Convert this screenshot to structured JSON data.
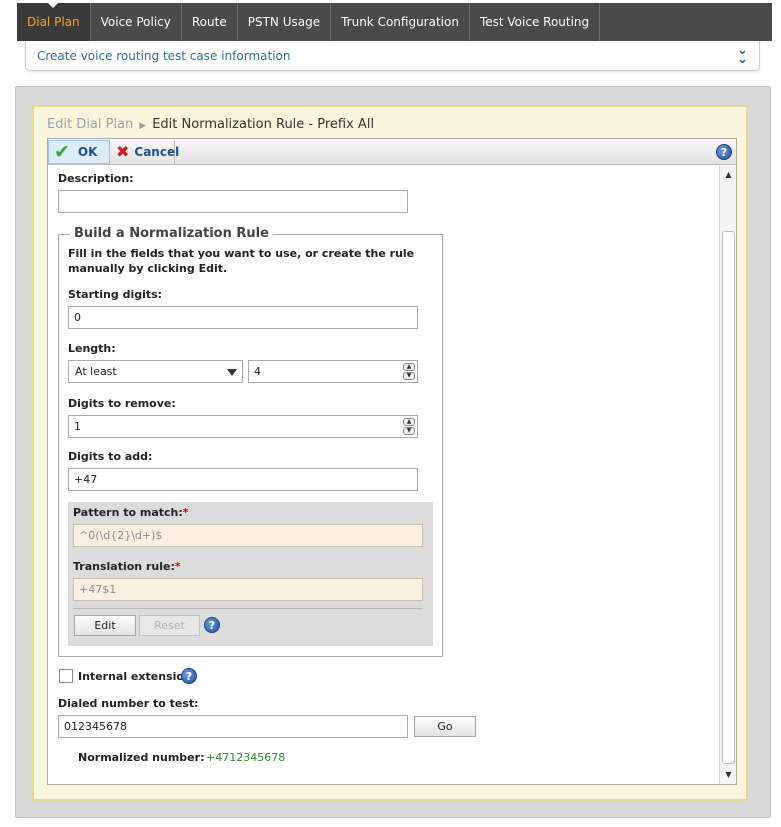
{
  "nav": {
    "tabs": [
      {
        "label": "Dial Plan",
        "active": true
      },
      {
        "label": "Voice Policy"
      },
      {
        "label": "Route"
      },
      {
        "label": "PSTN Usage"
      },
      {
        "label": "Trunk Configuration"
      },
      {
        "label": "Test Voice Routing"
      }
    ]
  },
  "infobar": {
    "text": "Create voice routing test case information",
    "icon": "double-chevron-down-icon"
  },
  "breadcrumb": {
    "parent": "Edit Dial Plan",
    "current": "Edit Normalization Rule - Prefix All"
  },
  "toolbar": {
    "ok_label": "OK",
    "cancel_label": "Cancel",
    "help": "?"
  },
  "form": {
    "description_label": "Description:",
    "description_value": "",
    "builder": {
      "legend": "Build a Normalization Rule",
      "note": "Fill in the fields that you want to use, or create the rule manually by clicking Edit.",
      "starting_digits_label": "Starting digits:",
      "starting_digits_value": "0",
      "length_label": "Length:",
      "length_mode": "At least",
      "length_value": "4",
      "remove_label": "Digits to remove:",
      "remove_value": "1",
      "add_label": "Digits to add:",
      "add_value": "+47",
      "pattern_label": "Pattern to match:",
      "pattern_value": "^0(\\d{2}\\d+)$",
      "translation_label": "Translation rule:",
      "translation_value": "+47$1",
      "required_mark": "*",
      "edit_label": "Edit",
      "reset_label": "Reset"
    },
    "internal_extension_label": "Internal extension",
    "internal_extension_checked": false,
    "dialed_label": "Dialed number to test:",
    "dialed_value": "012345678",
    "go_label": "Go",
    "normalized_label": "Normalized number:",
    "normalized_value": "+4712345678"
  },
  "colors": {
    "accent": "#f5a623",
    "link": "#2a6db5",
    "success": "#2b8a2b",
    "required": "#dd0000"
  }
}
